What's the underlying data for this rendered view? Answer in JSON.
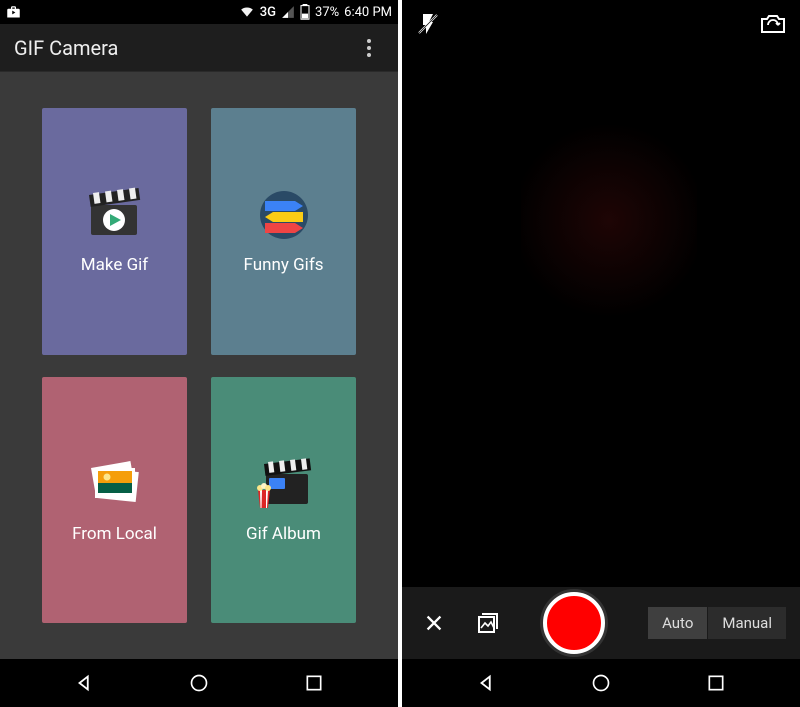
{
  "statusbar": {
    "network_label": "3G",
    "battery_pct": "37%",
    "time": "6:40 PM"
  },
  "left_screen": {
    "app_title": "GIF Camera",
    "tiles": {
      "make_gif": {
        "label": "Make Gif"
      },
      "funny_gifs": {
        "label": "Funny Gifs"
      },
      "from_local": {
        "label": "From Local"
      },
      "gif_album": {
        "label": "Gif Album"
      }
    }
  },
  "right_screen": {
    "mode_auto": "Auto",
    "mode_manual": "Manual"
  },
  "colors": {
    "tile_purple": "#6a6a9e",
    "tile_blue": "#5c7f8f",
    "tile_rose": "#b06272",
    "tile_teal": "#4a8c78",
    "shutter_red": "#ff0000"
  }
}
